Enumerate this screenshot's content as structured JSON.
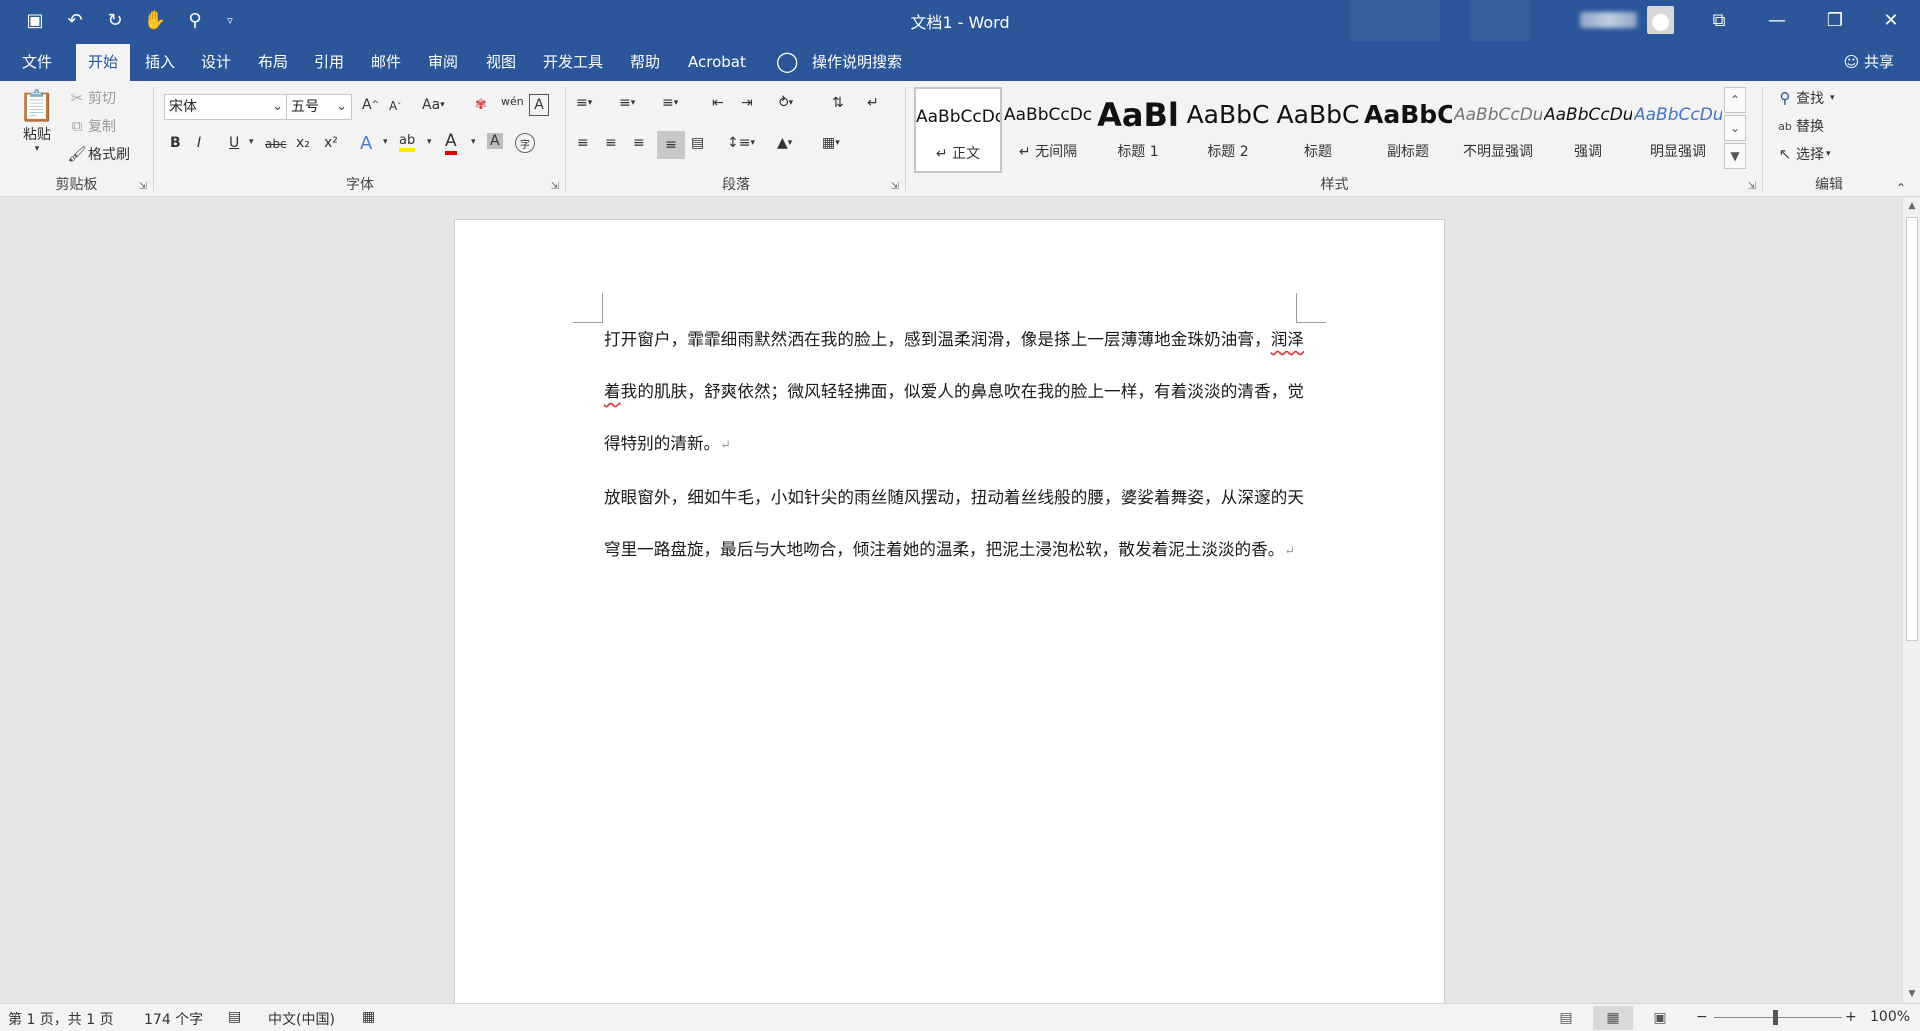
{
  "title_bar": {
    "document_title": "文档1 - Word",
    "quick_access": [
      {
        "name": "save-icon",
        "glyph": "💾"
      },
      {
        "name": "undo-icon",
        "glyph": "↶"
      },
      {
        "name": "redo-icon",
        "glyph": "↻"
      },
      {
        "name": "touch-mode-icon",
        "glyph": "✋"
      },
      {
        "name": "print-preview-icon",
        "glyph": "🔍"
      },
      {
        "name": "customize-qat-icon",
        "glyph": "▿"
      }
    ],
    "window_controls": {
      "ribbon_display": "⧉",
      "minimize": "—",
      "restore": "❐",
      "close": "✕"
    }
  },
  "menu": {
    "tabs": [
      "文件",
      "开始",
      "插入",
      "设计",
      "布局",
      "引用",
      "邮件",
      "审阅",
      "视图",
      "开发工具",
      "帮助",
      "Acrobat"
    ],
    "active_tab": "开始",
    "tell_me": "操作说明搜索",
    "share": "共享"
  },
  "ribbon": {
    "clipboard": {
      "label": "剪贴板",
      "paste": "粘贴",
      "cut": "剪切",
      "copy": "复制",
      "format_painter": "格式刷"
    },
    "font": {
      "label": "字体",
      "font_name": "宋体",
      "font_size": "五号",
      "grow": "A",
      "shrink": "A",
      "change_case": "Aa",
      "bold": "B",
      "italic": "I",
      "underline": "U",
      "strike": "abc",
      "subscript": "x₂",
      "superscript": "x²",
      "text_effects": "A",
      "highlight": "ab",
      "font_color": "A",
      "char_shading": "A",
      "enclose": "字",
      "phonetic": "wén",
      "char_border": "A"
    },
    "paragraph": {
      "label": "段落"
    },
    "styles": {
      "label": "样式",
      "items": [
        {
          "preview": "AaBbCcDc",
          "name": "↵ 正文"
        },
        {
          "preview": "AaBbCcDc",
          "name": "↵ 无间隔"
        },
        {
          "preview": "AaBl",
          "name": "标题 1"
        },
        {
          "preview": "AaBbC",
          "name": "标题 2"
        },
        {
          "preview": "AaBbC",
          "name": "标题"
        },
        {
          "preview": "AaBbC",
          "name": "副标题"
        },
        {
          "preview": "AaBbCcDu",
          "name": "不明显强调"
        },
        {
          "preview": "AaBbCcDu",
          "name": "强调"
        },
        {
          "preview": "AaBbCcDu",
          "name": "明显强调"
        }
      ]
    },
    "editing": {
      "label": "编辑",
      "find": "查找",
      "replace": "替换",
      "select": "选择"
    }
  },
  "document": {
    "paragraphs": [
      {
        "squiggle": "",
        "text": "打开窗户，霏霏细雨默然洒在我的脸上，感到温柔润滑，像是搽上一层薄薄地金珠奶油膏，",
        "text2_sq": "润泽着",
        "text2": "我的肌肤，舒爽依然；微风轻轻拂面，似爱人的鼻息吹在我的脸上一样，有着淡淡的清香，觉得特别的清新。"
      },
      {
        "text": "放眼窗外，细如牛毛，小如针尖的雨丝随风摆动，扭动着丝线般的腰，婆娑着舞姿，从深邃的天穹里一路盘旋，最后与大地吻合，倾注着她的温柔，把泥土浸泡松软，散发着泥土淡淡的香。"
      }
    ],
    "paragraph_mark": "↵"
  },
  "status_bar": {
    "page": "第 1 页，共 1 页",
    "words": "174 个字",
    "language": "中文(中国)",
    "zoom": "100%",
    "zoom_minus": "−",
    "zoom_plus": "+"
  },
  "colors": {
    "accent": "#2b579a",
    "ribbon_bg": "#f3f3f3",
    "canvas_bg": "#e6e6e6"
  }
}
